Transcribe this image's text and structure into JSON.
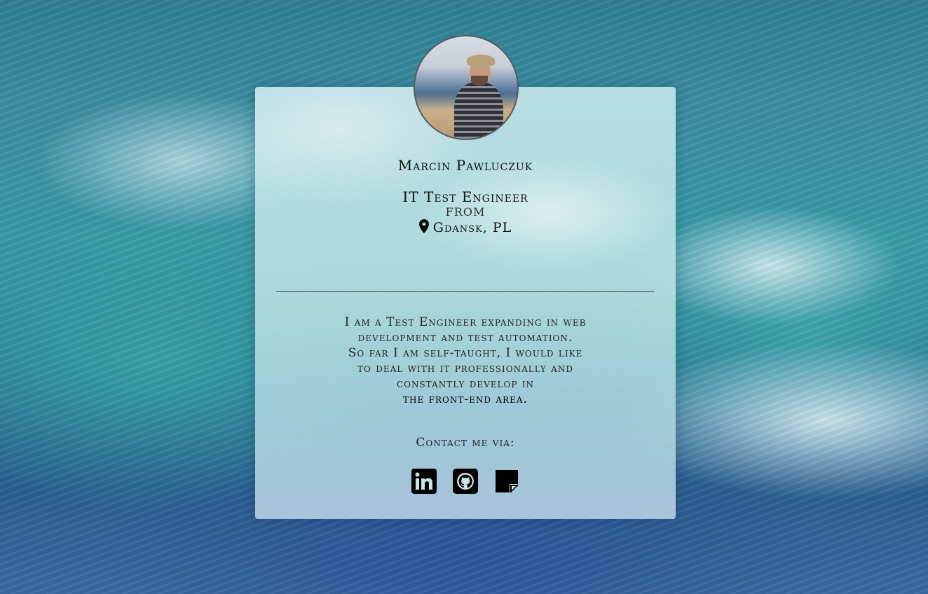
{
  "profile": {
    "name": "Marcin Pawluczuk",
    "job_title": "IT Test Engineer",
    "from_label": "FROM",
    "location": "Gdansk, PL"
  },
  "bio": {
    "lines": [
      "I am a Test Engineer expanding in web",
      "development and test automation.",
      "So far I am self-taught, I would like",
      "to deal with it professionally and",
      "constantly develop in"
    ],
    "emphasis": "the front-end area",
    "suffix": "."
  },
  "contact": {
    "label": "Contact me via:",
    "links": [
      {
        "icon": "linkedin-icon"
      },
      {
        "icon": "github-icon"
      },
      {
        "icon": "note-icon"
      }
    ]
  },
  "colors": {
    "text": "#111111",
    "card_tint": "#c8e8ec",
    "icon": "#000000"
  }
}
